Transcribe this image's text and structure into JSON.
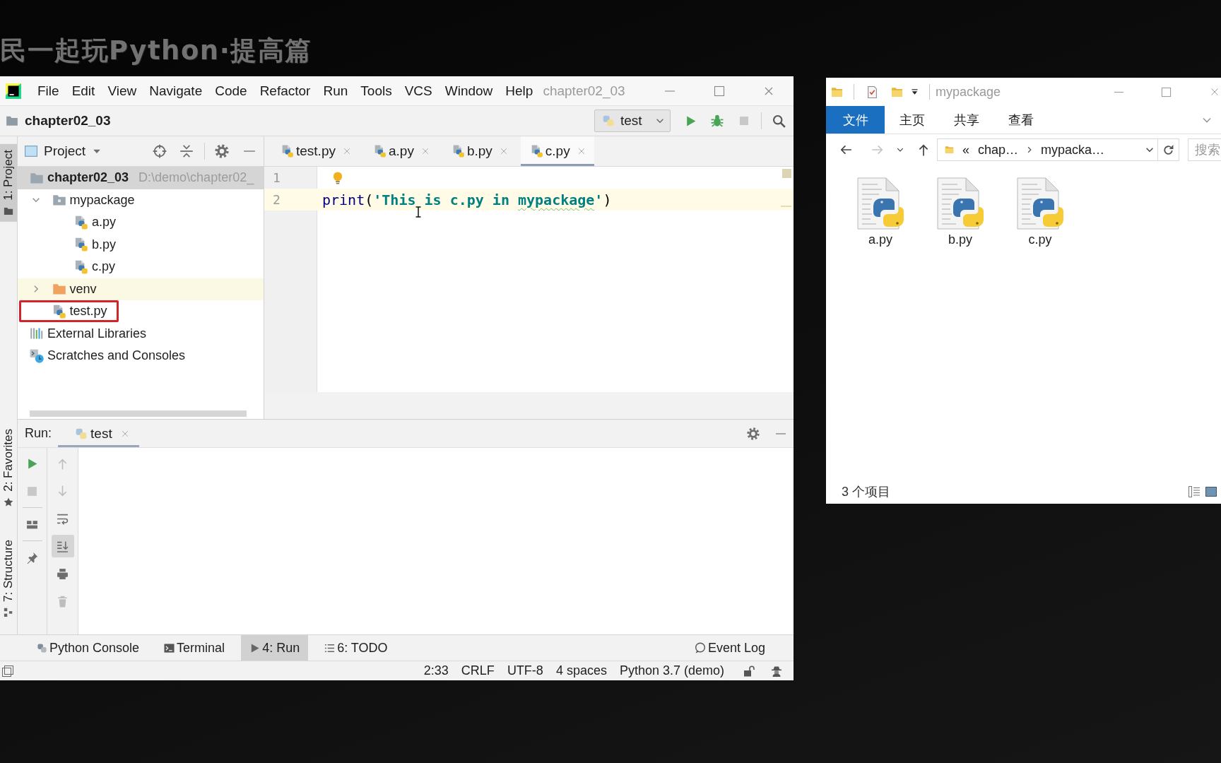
{
  "video_title": "民一起玩Python·提高篇",
  "ide": {
    "menu": [
      "File",
      "Edit",
      "View",
      "Navigate",
      "Code",
      "Refactor",
      "Run",
      "Tools",
      "VCS",
      "Window",
      "Help"
    ],
    "title": "chapter02_03",
    "nav": {
      "project": "chapter02_03",
      "run_config": "test"
    },
    "left_stripe": [
      {
        "label": "1: Project",
        "kind": "project",
        "selected": true
      },
      {
        "label": "2: Favorites",
        "kind": "favorites",
        "selected": false
      },
      {
        "label": "7: Structure",
        "kind": "structure",
        "selected": false
      }
    ],
    "project_panel": {
      "title": "Project",
      "tree": [
        {
          "label": "chapter02_03",
          "path": "D:\\demo\\chapter02_",
          "kind": "project",
          "selected": true,
          "children": [
            {
              "label": "mypackage",
              "kind": "package",
              "selected": false,
              "expanded": true,
              "children": [
                {
                  "label": "a.py",
                  "kind": "python",
                  "selected": false
                },
                {
                  "label": "b.py",
                  "kind": "python",
                  "selected": false
                },
                {
                  "label": "c.py",
                  "kind": "python",
                  "selected": false
                }
              ]
            },
            {
              "label": "venv",
              "kind": "excluded",
              "selected": false,
              "expanded": false
            },
            {
              "label": "test.py",
              "kind": "python",
              "selected": false,
              "outlined": true
            }
          ]
        },
        {
          "label": "External Libraries",
          "kind": "libraries",
          "selected": false
        },
        {
          "label": "Scratches and Consoles",
          "kind": "scratches",
          "selected": false
        }
      ]
    },
    "editor": {
      "tabs": [
        {
          "label": "test.py",
          "selected": false
        },
        {
          "label": "a.py",
          "selected": false
        },
        {
          "label": "b.py",
          "selected": false
        },
        {
          "label": "c.py",
          "selected": true
        }
      ],
      "lines": [
        {
          "number": "1",
          "current": false,
          "intention_bulb": true
        },
        {
          "number": "2",
          "current": true,
          "intention_bulb": false,
          "tokens": [
            {
              "kind": "builtin",
              "text": "print"
            },
            {
              "kind": "punct",
              "text": "("
            },
            {
              "kind": "string",
              "text": "'This is c.py in "
            },
            {
              "kind": "typo",
              "text": "mypackage"
            },
            {
              "kind": "string",
              "text": "'"
            },
            {
              "kind": "punct",
              "text": ")"
            }
          ]
        }
      ]
    },
    "run_panel": {
      "label": "Run:",
      "tabs": [
        {
          "label": "test",
          "selected": true
        }
      ],
      "toolbar": [
        [
          {
            "kind": "rerun",
            "disabled": false,
            "on": false
          },
          {
            "kind": "stop",
            "disabled": true,
            "on": false
          },
          {
            "kind": "separator"
          },
          {
            "kind": "layout",
            "disabled": false,
            "on": false
          },
          {
            "kind": "separator"
          },
          {
            "kind": "pin",
            "disabled": false,
            "on": false
          }
        ],
        [
          {
            "kind": "up",
            "disabled": true,
            "on": false
          },
          {
            "kind": "down",
            "disabled": true,
            "on": false
          },
          {
            "kind": "wrap",
            "disabled": false,
            "on": false
          },
          {
            "kind": "scroll-end",
            "disabled": false,
            "on": true
          },
          {
            "kind": "print",
            "disabled": false,
            "on": false
          },
          {
            "kind": "trash",
            "disabled": true,
            "on": false
          }
        ]
      ]
    },
    "tool_tabs": [
      {
        "label": "Python Console",
        "kind": "python-console",
        "selected": false
      },
      {
        "label": "Terminal",
        "kind": "terminal",
        "selected": false
      },
      {
        "label": "4: Run",
        "kind": "run",
        "selected": true
      },
      {
        "label": "6: TODO",
        "kind": "todo",
        "selected": false
      }
    ],
    "event_log": "Event Log",
    "status_bar": [
      "2:33",
      "CRLF",
      "UTF-8",
      "4 spaces",
      "Python 3.7 (demo)"
    ]
  },
  "explorer": {
    "title": "mypackage",
    "ribbon_tabs": [
      {
        "label": "文件",
        "selected": true
      },
      {
        "label": "主页",
        "selected": false
      },
      {
        "label": "共享",
        "selected": false
      },
      {
        "label": "查看",
        "selected": false
      }
    ],
    "nav_buttons": [
      {
        "kind": "back",
        "disabled": false
      },
      {
        "kind": "forward",
        "disabled": true
      },
      {
        "kind": "recent",
        "disabled": false
      },
      {
        "kind": "up",
        "disabled": false
      }
    ],
    "address": {
      "overflow": "«",
      "crumbs": [
        "chap…",
        "mypacka…"
      ]
    },
    "search": {
      "placeholder": "搜索"
    },
    "files": [
      "a.py",
      "b.py",
      "c.py"
    ],
    "status": "3 个项目"
  }
}
